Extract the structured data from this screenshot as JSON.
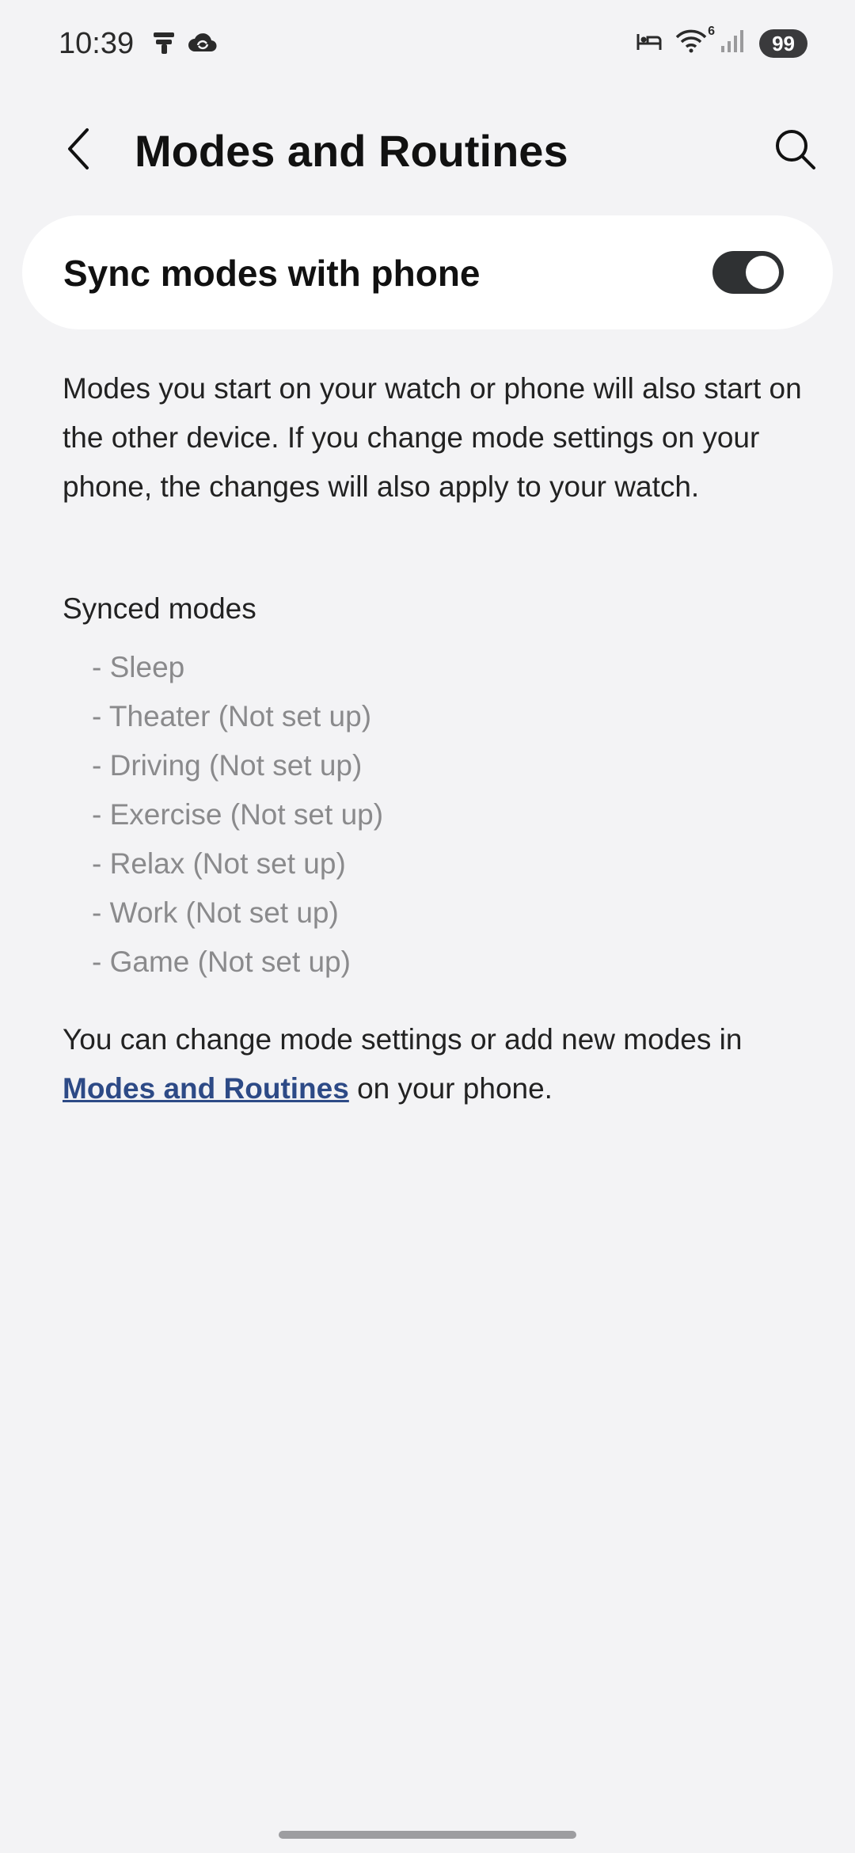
{
  "status_bar": {
    "time": "10:39",
    "battery": "99",
    "wifi_badge": "6",
    "left_icons": [
      "tiktok-icon",
      "cloud-sync-icon"
    ],
    "right_icons": [
      "bed-icon",
      "wifi-icon",
      "signal-icon"
    ]
  },
  "app_bar": {
    "title": "Modes and Routines",
    "back_icon": "chevron-left-icon",
    "search_icon": "search-icon"
  },
  "sync_card": {
    "label": "Sync modes with phone",
    "enabled": true
  },
  "description": "Modes you start on your watch or phone will also start on the other device. If you change mode settings on your phone, the changes will also apply to your watch.",
  "synced": {
    "heading": "Synced modes",
    "modes": [
      "- Sleep",
      "- Theater (Not set up)",
      "- Driving (Not set up)",
      "- Exercise (Not set up)",
      "- Relax (Not set up)",
      "- Work (Not set up)",
      "- Game (Not set up)"
    ]
  },
  "footer": {
    "prefix": "You can change mode settings or add new modes in ",
    "link": "Modes and Routines",
    "suffix": " on your phone."
  },
  "colors": {
    "background": "#f3f3f5",
    "card": "#ffffff",
    "toggle_on": "#2f3133",
    "link": "#2d4a86",
    "muted": "#8a8a8c"
  }
}
